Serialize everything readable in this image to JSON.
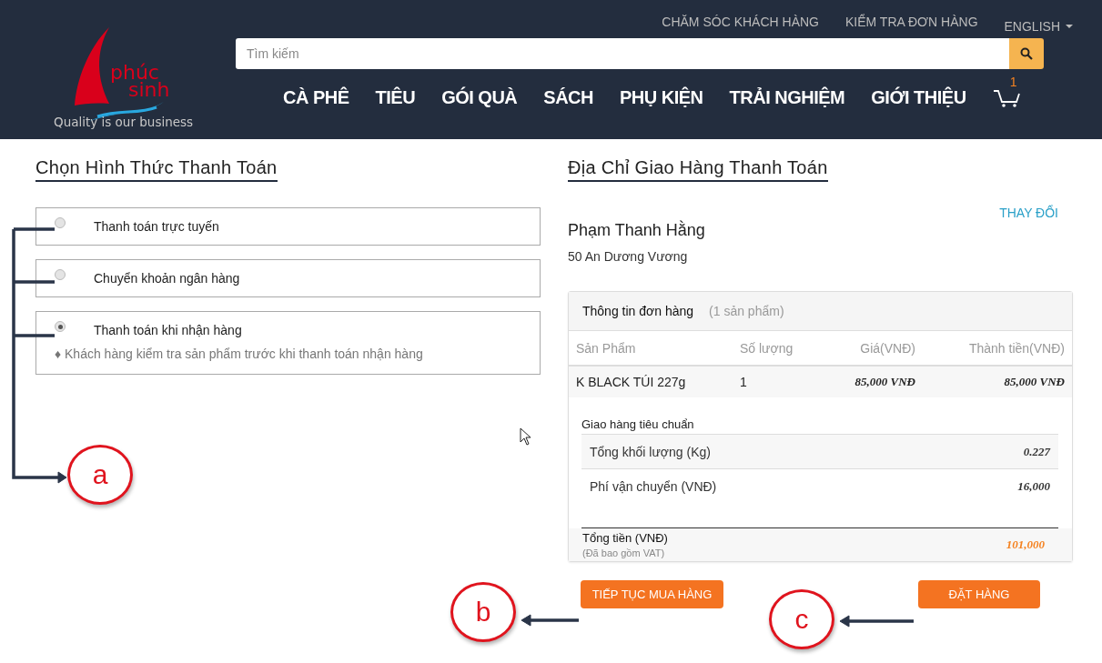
{
  "top_links": [
    {
      "label": "CHĂM SÓC KHÁCH HÀNG"
    },
    {
      "label": "KIỂM TRA ĐƠN HÀNG"
    }
  ],
  "language": "ENGLISH",
  "logo": {
    "line_1": "phúc",
    "line_2": "sinh",
    "tagline": "Quality is our business"
  },
  "search": {
    "placeholder": "Tìm kiếm"
  },
  "nav": [
    "CÀ PHÊ",
    "TIÊU",
    "GÓI QUÀ",
    "SÁCH",
    "PHỤ KIỆN",
    "TRẢI NGHIỆM",
    "GIỚI THIỆU"
  ],
  "cart": {
    "count": "1"
  },
  "payment": {
    "title": "Chọn Hình Thức Thanh Toán",
    "options": [
      {
        "label": "Thanh toán trực tuyến",
        "selected": false
      },
      {
        "label": "Chuyển khoản ngân hàng",
        "selected": false
      },
      {
        "label": "Thanh toán khi nhận hàng",
        "selected": true,
        "note": "♦ Khách hàng kiểm tra sản phẩm trước khi thanh toán nhận hàng"
      }
    ]
  },
  "shipping": {
    "title": "Địa Chỉ Giao Hàng Thanh Toán",
    "change_link": "THAY ĐỔI",
    "name": "Phạm Thanh Hằng",
    "address": "50 An Dương Vương"
  },
  "order": {
    "title": "Thông tin đơn hàng",
    "count": "(1 sản phẩm)",
    "columns": [
      "Sản Phẩm",
      "Số lượng",
      "Giá(VNĐ)",
      "Thành tiền(VNĐ)"
    ],
    "rows": [
      [
        "K BLACK TÚI 227g",
        "1",
        "85,000 VNĐ",
        "85,000 VNĐ"
      ]
    ],
    "shipping_method": "Giao hàng tiêu chuẩn",
    "details": [
      {
        "label": "Tổng khối lượng (Kg)",
        "value": "0.227"
      },
      {
        "label": "Phí vận chuyển (VNĐ)",
        "value": "16,000"
      }
    ],
    "total": {
      "label": "Tổng tiền (VNĐ)",
      "note": "(Đã bao gồm VAT)",
      "value": "101,000"
    }
  },
  "buttons": [
    {
      "label": "TIẾP TỤC MUA HÀNG",
      "kind": "continue"
    },
    {
      "label": "ĐẶT HÀNG",
      "kind": "order"
    }
  ],
  "annotations": [
    {
      "letter": "a"
    },
    {
      "letter": "b"
    },
    {
      "letter": "c"
    }
  ]
}
